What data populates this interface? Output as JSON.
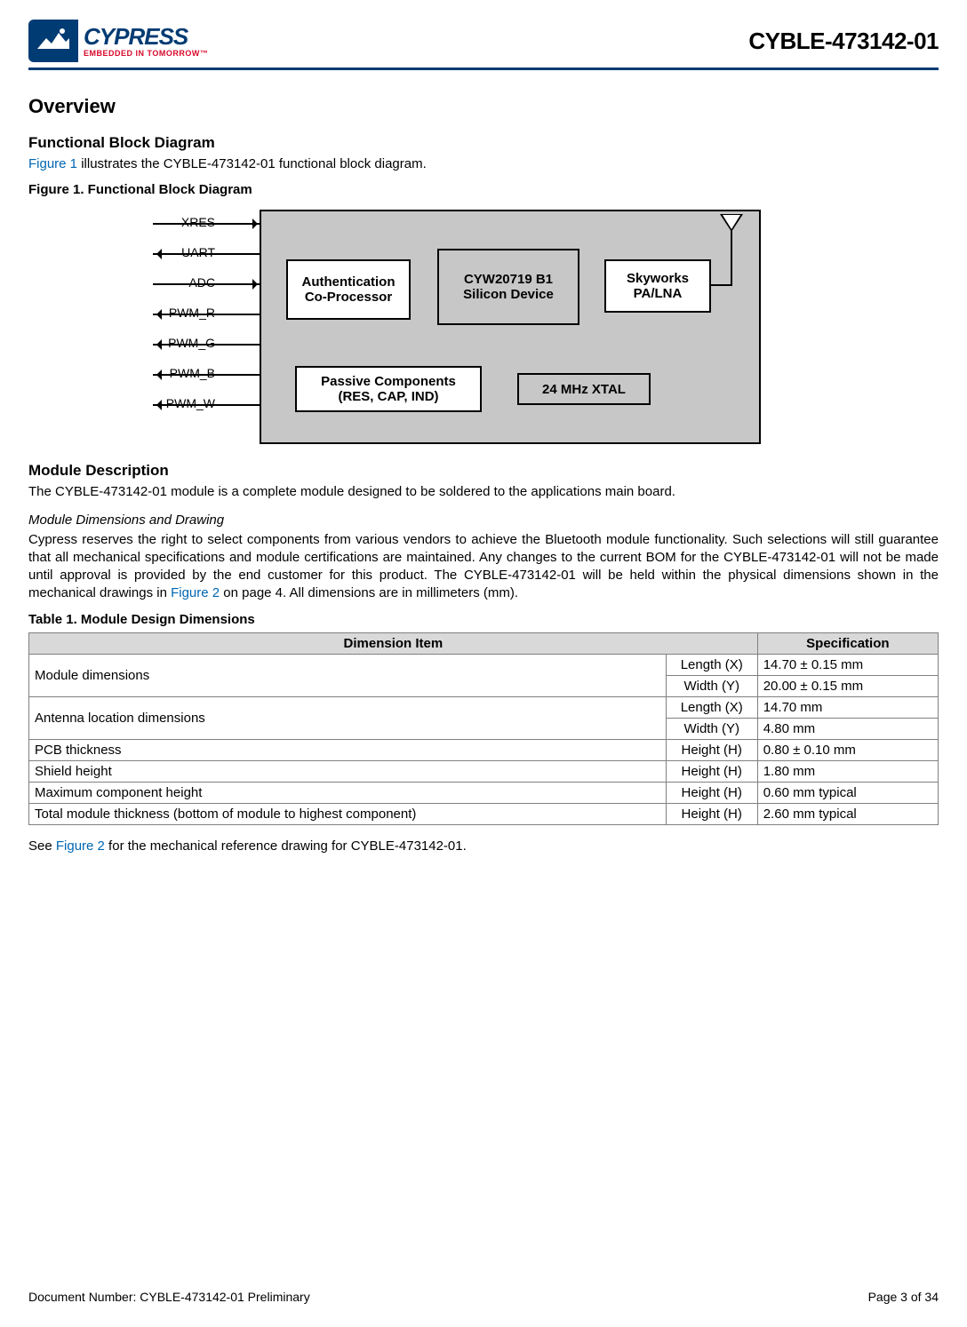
{
  "header": {
    "logo_word": "CYPRESS",
    "logo_tag": "EMBEDDED IN TOMORROW™",
    "part_no": "CYBLE-473142-01"
  },
  "overview_h": "Overview",
  "fbd_h": "Functional Block Diagram",
  "fig1_ref": "Figure 1",
  "fig1_sentence_tail": " illustrates the CYBLE-473142-01 functional block diagram.",
  "fig1_title": "Figure 1.  Functional Block Diagram",
  "signals": [
    "XRES",
    "UART",
    "ADC",
    "PWM_R",
    "PWM_G",
    "PWM_B",
    "PWM_W"
  ],
  "blocks": {
    "auth": "Authentication\nCo-Processor",
    "soc": "CYW20719 B1\nSilicon Device",
    "pa": "Skyworks\nPA/LNA",
    "passive": "Passive Components\n(RES, CAP, IND)",
    "xtal": "24 MHz XTAL"
  },
  "moddesc_h": "Module Description",
  "moddesc_p": "The CYBLE-473142-01 module is a complete module designed to be soldered to the applications main board.",
  "dims_h": "Module Dimensions and Drawing",
  "dims_p_pre": "Cypress reserves the right to select components from various vendors to achieve the Bluetooth module functionality. Such selections will still guarantee that all mechanical specifications and module certifications are maintained. Any changes to the current BOM for the CYBLE-473142-01 will not be made until approval is provided by the end customer for this product. The CYBLE-473142-01 will be held within the physical dimensions shown in the mechanical drawings in ",
  "fig2_ref": "Figure 2",
  "dims_p_post": " on page 4. All dimensions are in millimeters (mm).",
  "table1_title": "Table 1.  Module Design Dimensions",
  "table1": {
    "headers": [
      "Dimension Item",
      "",
      "Specification"
    ],
    "rows": [
      {
        "item": "Module dimensions",
        "axis": "Length (X)",
        "spec": "14.70 ± 0.15 mm",
        "rowspan": 2
      },
      {
        "item": "",
        "axis": "Width (Y)",
        "spec": "20.00 ± 0.15 mm"
      },
      {
        "item": "Antenna location dimensions",
        "axis": "Length (X)",
        "spec": "14.70 mm",
        "rowspan": 2
      },
      {
        "item": "",
        "axis": "Width (Y)",
        "spec": "4.80 mm"
      },
      {
        "item": "PCB thickness",
        "axis": "Height (H)",
        "spec": "0.80 ± 0.10 mm"
      },
      {
        "item": "Shield height",
        "axis": "Height (H)",
        "spec": "1.80 mm"
      },
      {
        "item": "Maximum component height",
        "axis": "Height (H)",
        "spec": "0.60 mm typical"
      },
      {
        "item": "Total module thickness (bottom of module to highest component)",
        "axis": "Height (H)",
        "spec": "2.60 mm typical"
      }
    ]
  },
  "see_fig2_pre": "See ",
  "see_fig2_post": " for the mechanical reference drawing for CYBLE-473142-01.",
  "footer": {
    "docnum": "Document Number: CYBLE-473142-01 Preliminary",
    "page": "Page 3 of 34"
  }
}
